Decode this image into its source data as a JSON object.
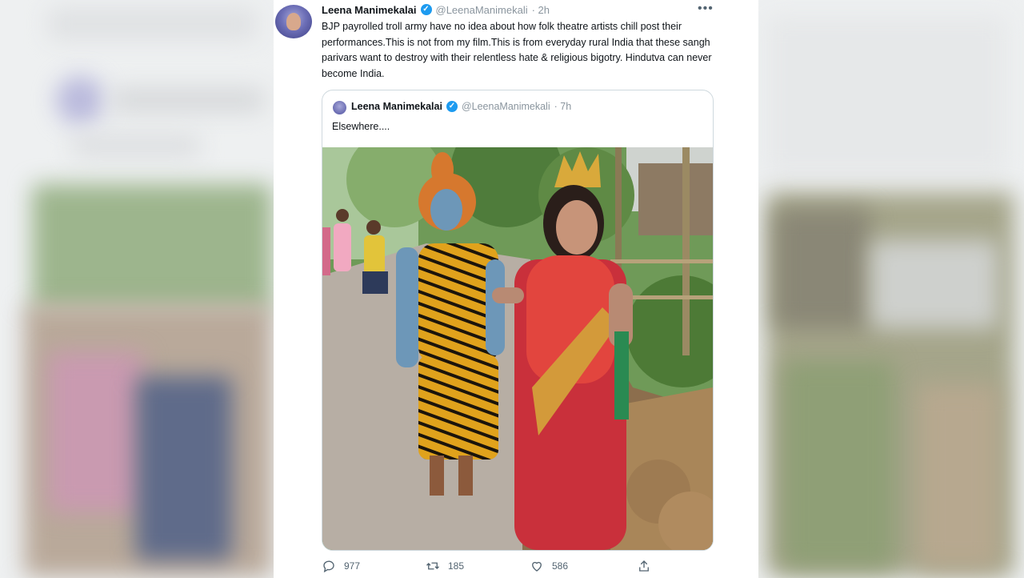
{
  "tweet": {
    "author_name": "Leena Manimekalai",
    "author_handle": "@LeenaManimekali",
    "time": "· 2h",
    "more_icon": "more-horizontal-icon",
    "text": "BJP payrolled troll army have no idea about how folk theatre artists chill post their performances.This is not from my film.This is from everyday rural India that these sangh parivars want to destroy with their relentless hate & religious bigotry. Hindutva can never become India.",
    "quoted": {
      "author_name": "Leena Manimekalai",
      "author_handle": "@LeenaManimekali",
      "time": "· 7h",
      "text": "Elsewhere....",
      "photo_icon": "folk-costume-photo"
    },
    "actions": {
      "replies": "977",
      "retweets": "185",
      "likes": "586"
    }
  },
  "colors": {
    "verified": "#1d9bf0",
    "text": "#0f1419",
    "muted": "#8a959e",
    "border": "#cfd9de"
  }
}
